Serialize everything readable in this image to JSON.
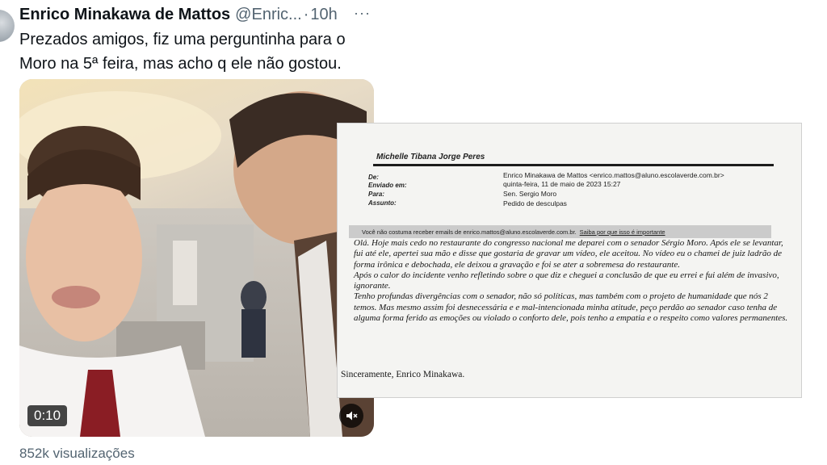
{
  "tweet": {
    "author_name": "Enrico Minakawa de Mattos",
    "author_handle": "@Enric...",
    "separator": "·",
    "time_ago": "10h",
    "more_label": "···",
    "text": "Prezados amigos, fiz uma perguntinha para o Moro na 5ª feira, mas acho q ele não gostou.",
    "views": "852k visualizações"
  },
  "video": {
    "duration": "0:10",
    "mute_icon": "speaker-muted-icon",
    "media_icon": "content-warning-icon"
  },
  "email": {
    "sender_header": "Michelle Tibana Jorge Peres",
    "fields": [
      {
        "label": "De:",
        "value": "Enrico Minakawa de Mattos <enrico.mattos@aluno.escolaverde.com.br>"
      },
      {
        "label": "Enviado em:",
        "value": "quinta-feira, 11 de maio de 2023 15:27"
      },
      {
        "label": "Para:",
        "value": "Sen. Sergio Moro"
      },
      {
        "label": "Assunto:",
        "value": "Pedido de desculpas"
      }
    ],
    "notice_text": "Você não costuma receber emails de enrico.mattos@aluno.escolaverde.com.br.",
    "notice_link": "Saiba por que isso é importante",
    "paragraphs": [
      "Olá. Hoje mais cedo no restaurante do congresso nacional me deparei com o senador Sérgio Moro. Após ele se levantar, fui até ele, apertei sua mão e disse que gostaria de gravar um vídeo, ele aceitou. No vídeo eu o chamei de juiz ladrão de forma irônica e debochada, ele deixou a gravação e foi se ater a sobremesa do restaurante.",
      "Após o calor do incidente venho refletindo sobre o que diz e cheguei a conclusão de que eu errei e fui além de invasivo, ignorante.",
      "Tenho profundas divergências com o senador, não só políticas, mas também com o projeto de humanidade que nós 2 temos. Mas mesmo assim foi desnecessária e e mal-intencionada minha atitude, peço perdão ao senador caso tenha de alguma forma ferido as emoções ou violado o conforto dele, pois tenho a empatia e o respeito como valores permanentes."
    ],
    "signoff": "Sinceramente, Enrico Minakawa."
  }
}
